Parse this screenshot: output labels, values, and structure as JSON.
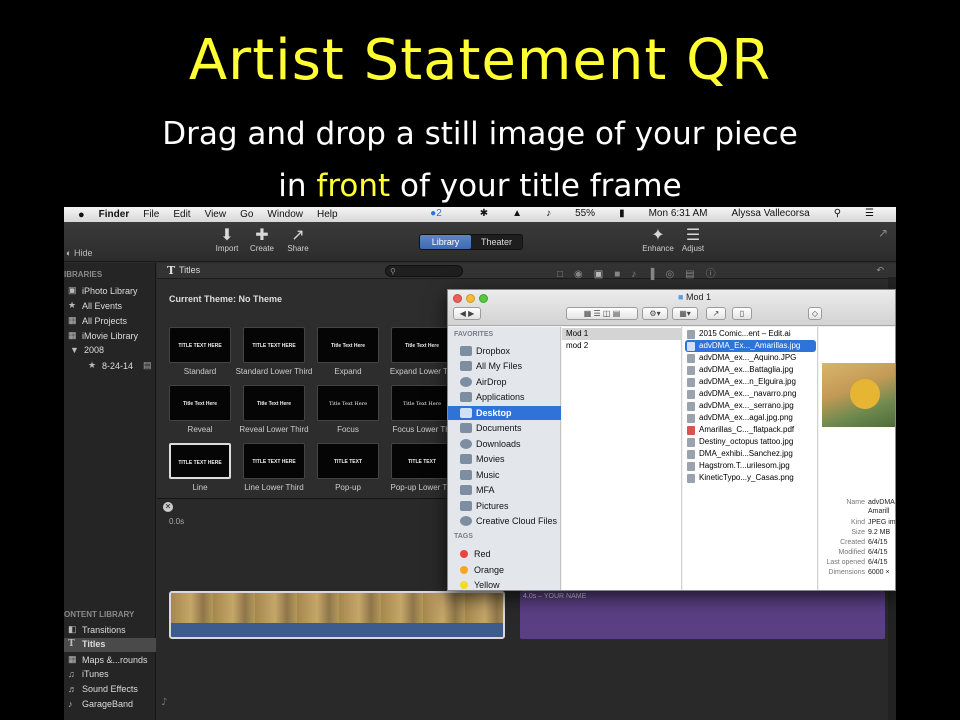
{
  "slide": {
    "title": "Artist Statement QR",
    "line1": "Drag and drop a still image of your piece",
    "line2_before": "in ",
    "line2_highlight": "front",
    "line2_after": " of your title frame"
  },
  "menubar": {
    "apple": "",
    "items": [
      "Finder",
      "File",
      "Edit",
      "View",
      "Go",
      "Window",
      "Help"
    ],
    "battery": "55%",
    "clock": "Mon 6:31 AM",
    "user": "Alyssa Vallecorsa",
    "badge": "2"
  },
  "toolbar": {
    "hide": "Hide",
    "import": "Import",
    "create": "Create",
    "share": "Share",
    "library": "Library",
    "theater": "Theater",
    "enhance": "Enhance",
    "adjust": "Adjust"
  },
  "sidebar": {
    "libraries_head": "IBRARIES",
    "items": [
      "iPhoto Library",
      "All Events",
      "All Projects",
      "iMovie Library",
      "2008",
      "8-24-14"
    ],
    "content_head": "ONTENT LIBRARY",
    "content_items": [
      "Transitions",
      "Titles",
      "Maps &...rounds",
      "iTunes",
      "Sound Effects",
      "GarageBand"
    ]
  },
  "browser": {
    "header": "Titles",
    "theme": "Current Theme: No Theme",
    "thumbs": [
      {
        "label": "Standard",
        "text": "TITLE TEXT HERE"
      },
      {
        "label": "Standard Lower Third",
        "text": "TITLE TEXT HERE"
      },
      {
        "label": "Expand",
        "text": "Title Text Here"
      },
      {
        "label": "Expand Lower Thi",
        "text": "Title Text Here"
      },
      {
        "label": "Reveal",
        "text": "Title Text Here"
      },
      {
        "label": "Reveal Lower Third",
        "text": "Title Text Here"
      },
      {
        "label": "Focus",
        "text": "Title Text Here"
      },
      {
        "label": "Focus Lower Thi",
        "text": "Title Text Here"
      },
      {
        "label": "Line",
        "text": "TITLE TEXT HERE"
      },
      {
        "label": "Line Lower Third",
        "text": "TITLE TEXT HERE"
      },
      {
        "label": "Pop-up",
        "text": "TITLE TEXT"
      },
      {
        "label": "Pop-up Lower Thi",
        "text": "TITLE TEXT"
      }
    ]
  },
  "timeline": {
    "time": "0.0s",
    "clip2_label": "4.0s – YOUR NAME"
  },
  "finder": {
    "title": "Mod 1",
    "favorites_head": "FAVORITES",
    "favorites": [
      "Dropbox",
      "All My Files",
      "AirDrop",
      "Applications",
      "Desktop",
      "Documents",
      "Downloads",
      "Movies",
      "Music",
      "MFA",
      "Pictures",
      "Creative Cloud Files"
    ],
    "tags_head": "TAGS",
    "tags": [
      {
        "name": "Red",
        "color": "#e8453c"
      },
      {
        "name": "Orange",
        "color": "#f5a623"
      },
      {
        "name": "Yellow",
        "color": "#f2dc22"
      }
    ],
    "col1": [
      "Mod 1",
      "mod 2"
    ],
    "files": [
      "2015 Comic...ent – Edit.ai",
      "advDMA_Ex..._Amarillas.jpg",
      "advDMA_ex..._Aquino.JPG",
      "advDMA_ex...Battaglia.jpg",
      "advDMA_ex...n_Elguira.jpg",
      "advDMA_ex..._navarro.png",
      "advDMA_ex..._serrano.jpg",
      "advDMA_ex...agal.jpg.png",
      "Amarillas_C..._flatpack.pdf",
      "Destiny_octopus tattoo.jpg",
      "DMA_exhibi...Sanchez.jpg",
      "Hagstrom.T...urilesom.jpg",
      "KineticTypo...y_Casas.png"
    ],
    "meta": [
      {
        "k": "Name",
        "v": "advDMA"
      },
      {
        "k": "",
        "v": "Amarill"
      },
      {
        "k": "Kind",
        "v": "JPEG im"
      },
      {
        "k": "Size",
        "v": "9.2 MB"
      },
      {
        "k": "Created",
        "v": "6/4/15"
      },
      {
        "k": "Modified",
        "v": "6/4/15"
      },
      {
        "k": "Last opened",
        "v": "6/4/15"
      },
      {
        "k": "Dimensions",
        "v": "6000 ×"
      }
    ]
  }
}
